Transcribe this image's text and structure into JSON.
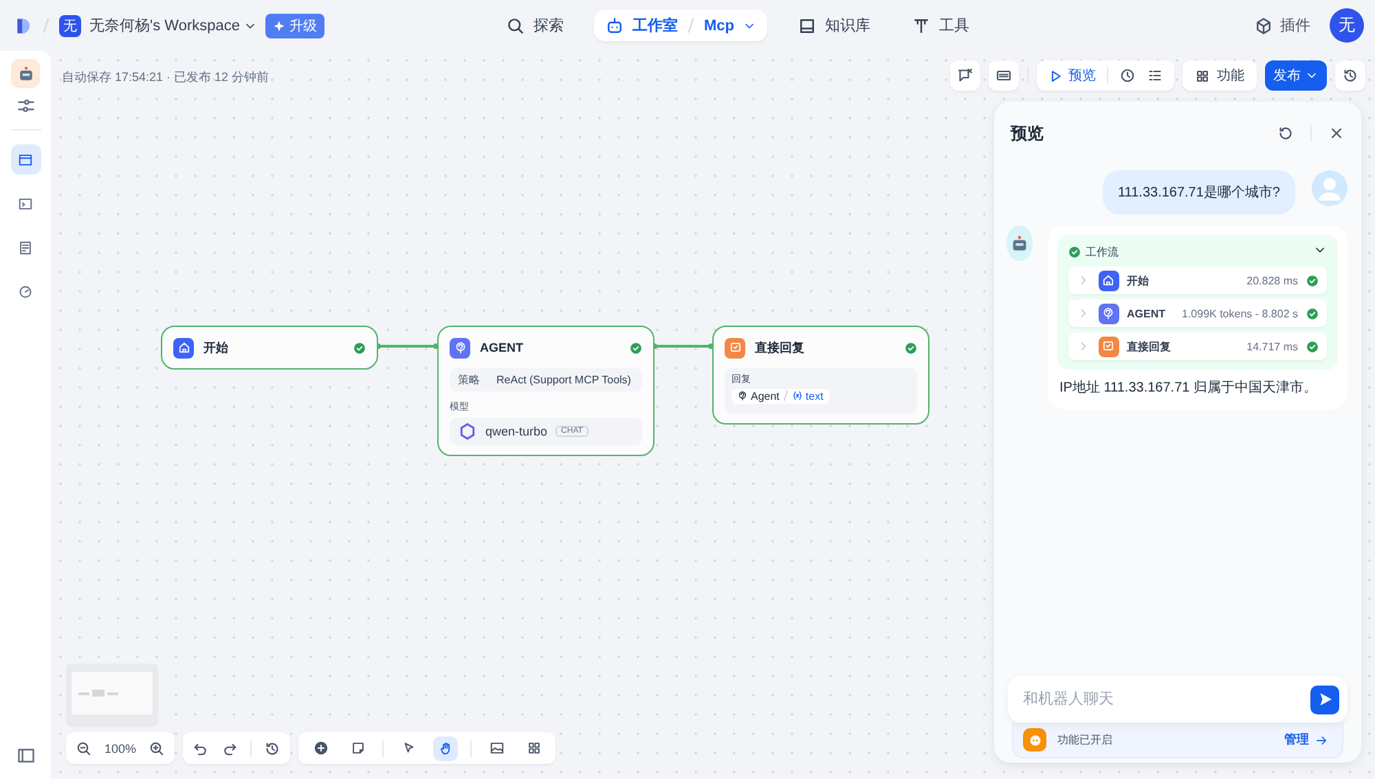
{
  "header": {
    "workspace_avatar": "无",
    "workspace": "无奈何杨's Workspace",
    "upgrade": "升级",
    "nav": [
      {
        "kind": "explore",
        "label": "探索",
        "selected": false
      },
      {
        "kind": "studio",
        "label": "工作室",
        "sub": "Mcp",
        "selected": true
      },
      {
        "kind": "knowledge",
        "label": "知识库",
        "selected": false
      },
      {
        "kind": "tools",
        "label": "工具",
        "selected": false
      }
    ],
    "plugins": "插件",
    "user_avatar": "无"
  },
  "sidebar": {
    "items": [
      {
        "kind": "window",
        "selected": true
      },
      {
        "kind": "terminal",
        "selected": false
      },
      {
        "kind": "doc",
        "selected": false
      },
      {
        "kind": "gauge",
        "selected": false
      }
    ]
  },
  "canvas": {
    "status": "自动保存 17:54:21 · 已发布 12 分钟前",
    "toolbar": {
      "preview": "预览",
      "features": "功能",
      "publish": "发布"
    },
    "nodes": [
      {
        "kind": "start",
        "title": "开始",
        "done": true
      },
      {
        "kind": "agent",
        "title": "AGENT",
        "done": true,
        "strategy_label": "策略",
        "strategy": "ReAct (Support MCP Tools)",
        "model_label": "模型",
        "model": "qwen-turbo",
        "model_tag": "CHAT"
      },
      {
        "kind": "reply",
        "title": "直接回复",
        "done": true,
        "reply_label": "回复",
        "source": "Agent",
        "variable": "text"
      }
    ],
    "zoom": "100%",
    "tools": [
      {
        "kind": "add",
        "selected": false
      },
      {
        "kind": "note",
        "selected": false
      },
      {
        "kind": "pointer",
        "selected": false
      },
      {
        "kind": "hand",
        "selected": true
      },
      {
        "kind": "image",
        "selected": false
      },
      {
        "kind": "layout",
        "selected": false
      }
    ]
  },
  "preview": {
    "title": "预览",
    "messages": [
      {
        "kind": "user",
        "text": "111.33.167.71是哪个城市?"
      },
      {
        "kind": "assistant",
        "workflow": {
          "title": "工作流",
          "done": true,
          "expanded": true,
          "steps": [
            {
              "kind": "start",
              "name": "开始",
              "metric": "20.828 ms",
              "done": true
            },
            {
              "kind": "agent",
              "name": "AGENT",
              "metric": "1.099K tokens - 8.802 s",
              "done": true
            },
            {
              "kind": "reply",
              "name": "直接回复",
              "metric": "14.717 ms",
              "done": true
            }
          ]
        },
        "text": "IP地址 111.33.167.71 归属于中国天津市。"
      }
    ],
    "placeholder": "和机器人聊天",
    "features": "功能已开启",
    "manage": "管理"
  }
}
